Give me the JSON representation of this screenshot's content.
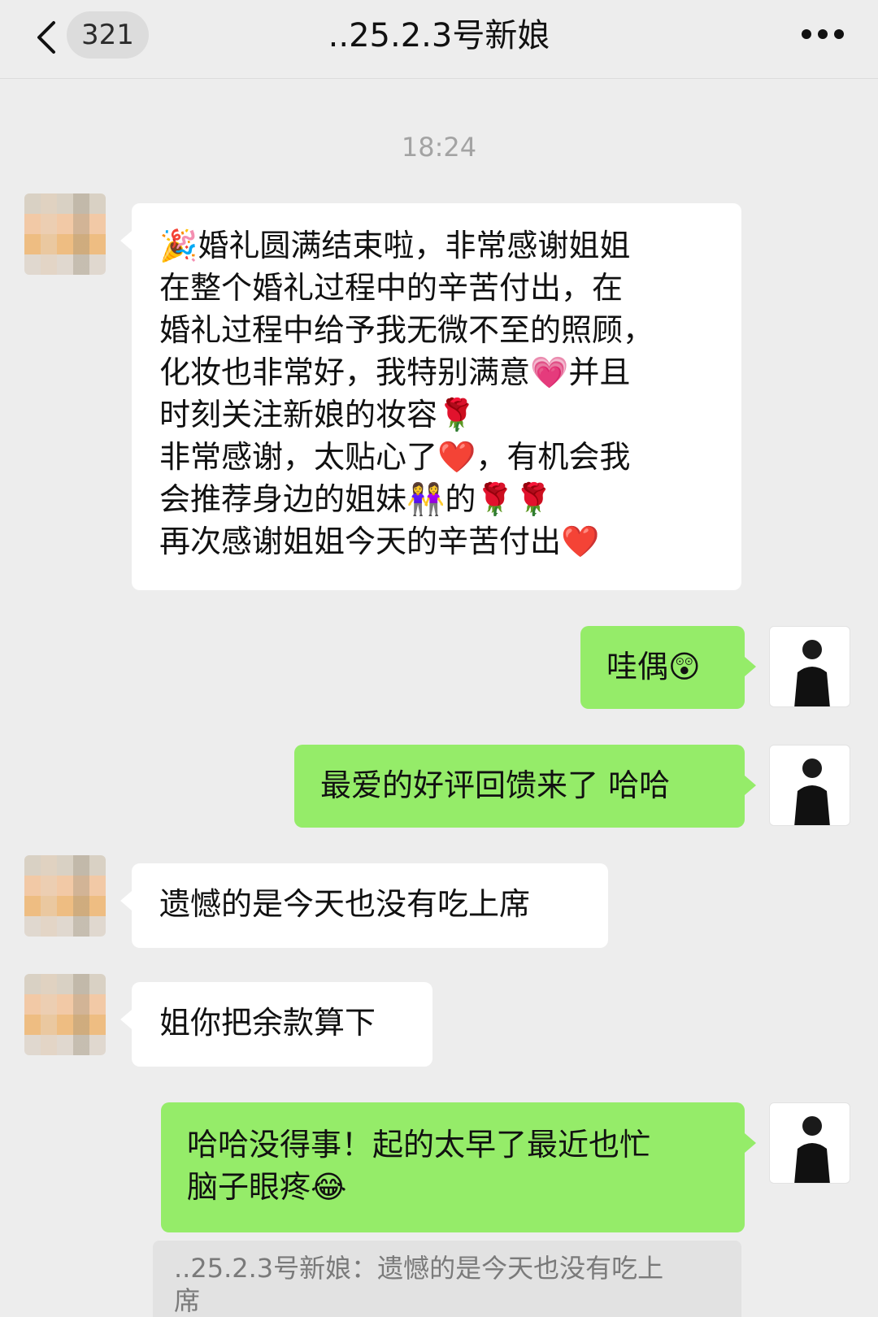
{
  "header": {
    "unread_badge": "321",
    "title": "..25.2.3号新娘"
  },
  "icons": {
    "back": "chevron-left-icon",
    "more": "more-dots-icon"
  },
  "timestamp": "18:24",
  "messages": [
    {
      "side": "left",
      "lines": [
        "🎉婚礼圆满结束啦，非常感谢姐姐",
        "在整个婚礼过程中的辛苦付出，在",
        "婚礼过程中给予我无微不至的照顾，",
        "化妆也非常好，我特别满意💗并且",
        "时刻关注新娘的妆容🌹",
        "非常感谢，太贴心了❤️，有机会我",
        "会推荐身边的姐妹👭的🌹🌹",
        "再次感谢姐姐今天的辛苦付出❤️"
      ]
    },
    {
      "side": "right",
      "text": "哇偶😲"
    },
    {
      "side": "right",
      "text": "最爱的好评回馈来了 哈哈"
    },
    {
      "side": "left",
      "text": "遗憾的是今天也没有吃上席"
    },
    {
      "side": "left",
      "text": "姐你把余款算下"
    },
    {
      "side": "right",
      "lines": [
        "哈哈没得事！起的太早了最近也忙",
        "脑子眼疼😂"
      ]
    }
  ],
  "quote": {
    "lines": [
      "..25.2.3号新娘：遗憾的是今天也没有吃上",
      "席"
    ]
  },
  "colors": {
    "background": "#ededed",
    "bubble_green": "#95ec69",
    "bubble_white": "#ffffff",
    "timestamp": "#a3a3a3"
  }
}
